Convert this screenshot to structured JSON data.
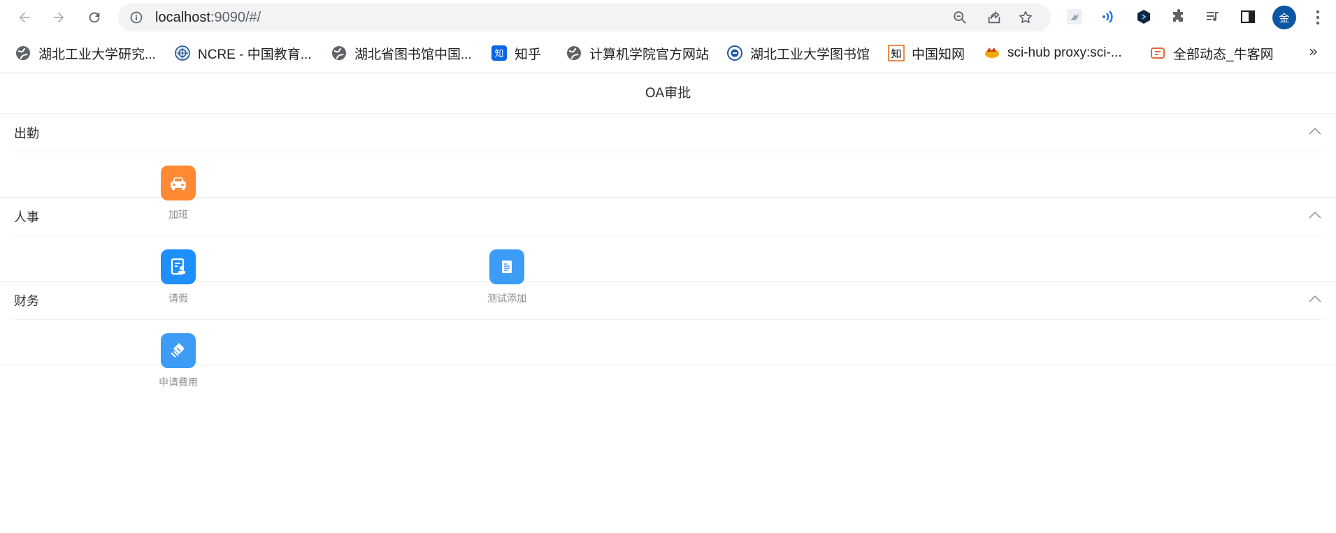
{
  "browser": {
    "url_host": "localhost",
    "url_rest": ":9090/#/",
    "avatar_initial": "金",
    "bookmarks": [
      {
        "label": "湖北工业大学研究...",
        "icon": "globe-icon"
      },
      {
        "label": "NCRE - 中国教育...",
        "icon": "ncre-logo-icon"
      },
      {
        "label": "湖北省图书馆中国...",
        "icon": "globe-icon"
      },
      {
        "label": "知乎",
        "icon": "zhihu-icon"
      },
      {
        "label": "计算机学院官方网站",
        "icon": "globe-icon"
      },
      {
        "label": "湖北工业大学图书馆",
        "icon": "library-logo-icon"
      },
      {
        "label": "中国知网",
        "icon": "cnki-icon"
      },
      {
        "label": "sci-hub proxy:sci-...",
        "icon": "scihub-icon"
      },
      {
        "label": "全部动态_牛客网",
        "icon": "nowcoder-icon"
      }
    ],
    "more_bookmarks": "»"
  },
  "page": {
    "title": "OA审批",
    "sections": [
      {
        "title": "出勤",
        "apps": [
          {
            "label": "加班",
            "icon": "car-icon",
            "color": "#ff8a33"
          }
        ]
      },
      {
        "title": "人事",
        "apps": [
          {
            "label": "请假",
            "icon": "leave-form-icon",
            "color": "#1e8fff"
          },
          {
            "label": "测试添加",
            "icon": "document-icon",
            "color": "#3d9cf5"
          }
        ]
      },
      {
        "title": "财务",
        "apps": [
          {
            "label": "申请费用",
            "icon": "expense-icon",
            "color": "#3d9cf5"
          }
        ]
      }
    ]
  }
}
